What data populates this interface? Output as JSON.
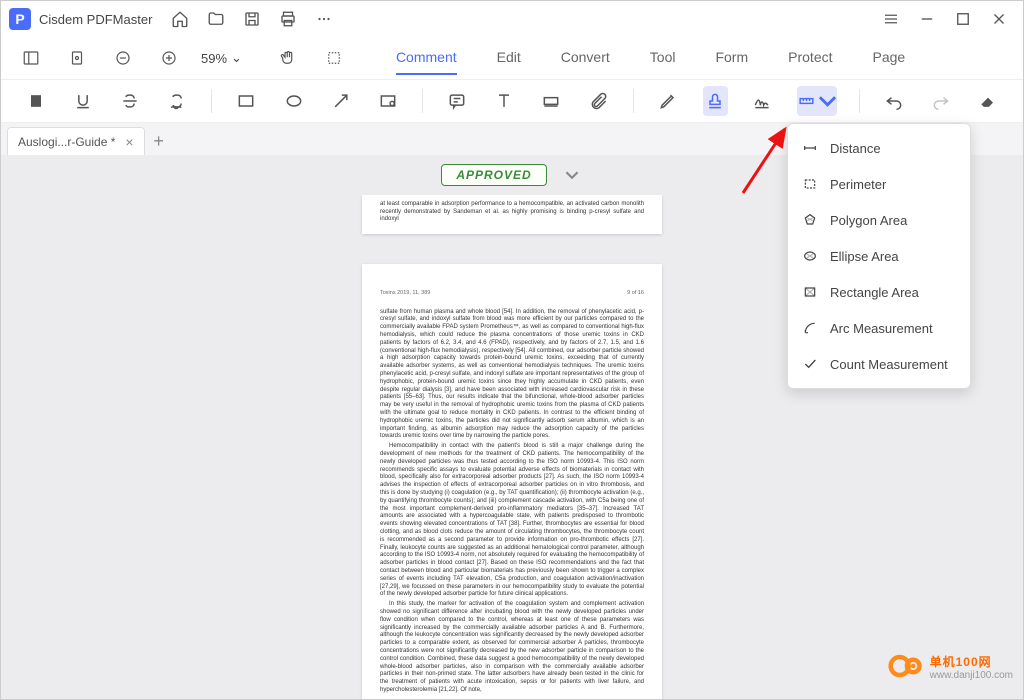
{
  "app": {
    "logo_letter": "P",
    "name": "Cisdem PDFMaster"
  },
  "zoom": {
    "value": "59%",
    "caret": "⌄"
  },
  "tabs": [
    "Comment",
    "Edit",
    "Convert",
    "Tool",
    "Form",
    "Protect",
    "Page"
  ],
  "active_tab": "Comment",
  "file": {
    "name": "Auslogi...r-Guide *",
    "close": "×"
  },
  "stamp": {
    "label": "APPROVED"
  },
  "menu": {
    "items": [
      {
        "label": "Distance"
      },
      {
        "label": "Perimeter"
      },
      {
        "label": "Polygon Area"
      },
      {
        "label": "Ellipse Area"
      },
      {
        "label": "Rectangle Area"
      },
      {
        "label": "Arc Measurement"
      },
      {
        "label": "Count Measurement"
      }
    ]
  },
  "doc": {
    "frag": "at least comparable in adsorption performance to a hemocompatible, an activated carbon monolith recently demonstrated by Sandeman et al. as highly promising is binding p-cresyl sulfate and indoxyl",
    "header_left": "Toxins 2019, 11, 389",
    "header_right": "9 of 16",
    "p1": "sulfate from human plasma and whole blood [54]. In addition, the removal of phenylacetic acid, p-cresyl sulfate, and indoxyl sulfate from blood was more efficient by our particles compared to the commercially available FPAD system Prometheus™, as well as compared to conventional high-flux hemodialysis, which could reduce the plasma concentrations of those uremic toxins in CKD patients by factors of 6.2, 3.4, and 4.6 (FPAD), respectively, and by factors of 2.7, 1.5, and 1.6 (conventional high-flux hemodialysis), respectively [54]. All combined, our adsorber particle showed a high adsorption capacity towards protein-bound uremic toxins, exceeding that of currently available adsorber systems, as well as conventional hemodialysis techniques. The uremic toxins phenylacetic acid, p-cresyl sulfate, and indoxyl sulfate are important representatives of the group of hydrophobic, protein-bound uremic toxins since they highly accumulate in CKD patients, even despite regular dialysis [3], and have been associated with increased cardiovascular risk in these patients [55–63]. Thus, our results indicate that the bifunctional, whole-blood adsorber particles may be very useful in the removal of hydrophobic uremic toxins from the plasma of CKD patients with the ultimate goal to reduce mortality in CKD patients. In contrast to the efficient binding of hydrophobic uremic toxins, the particles did not significantly adsorb serum albumin, which is an important finding, as albumin adsorption may reduce the adsorption capacity of the particles towards uremic toxins over time by narrowing the particle pores.",
    "p2": "Hemocompatibility in contact with the patient's blood is still a major challenge during the development of new methods for the treatment of CKD patients. The hemocompatibility of the newly developed particles was thus tested according to the ISO norm 10993-4. This ISO norm recommends specific assays to evaluate potential adverse effects of biomaterials in contact with blood, specifically also for extracorporeal adsorber products [27]. As such, the ISO norm 10993-4 advises the inspection of effects of extracorporeal adsorber particles on in vitro thrombosis, and this is done by studying (i) coagulation (e.g., by TAT quantification); (ii) thrombocyte activation (e.g., by quantifying thrombocyte counts); and (iii) complement cascade activation, with C5a being one of the most important complement-derived pro-inflammatory mediators [35–37]. Increased TAT amounts are associated with a hypercoagulable state, with patients predisposed to thrombotic events showing elevated concentrations of TAT [38]. Further, thrombocytes are essential for blood clotting, and as blood clots reduce the amount of circulating thrombocytes, the thrombocyte count is recommended as a second parameter to provide information on pro-thrombotic effects [27]. Finally, leukocyte counts are suggested as an additional hematological control parameter, although according to the ISO 10993-4 norm, not absolutely required for evaluating the hemocompatibility of adsorber particles in blood contact [27]. Based on these ISO recommendations and the fact that contact between blood and particular biomaterials has previously been shown to trigger a complex series of events including TAT elevation, C5a production, and coagulation activation/inactivation [27,29], we focussed on these parameters in our hemocompatibility study to evaluate the potential of the newly developed adsorber particle for future clinical applications.",
    "p3": "In this study, the marker for activation of the coagulation system and complement activation showed no significant difference after incubating blood with the newly developed particles under flow condition when compared to the control, whereas at least one of these parameters was significantly increased by the commercially available adsorber particles A and B. Furthermore, although the leukocyte concentration was significantly decreased by the newly developed adsorber particles to a comparable extent, as observed for commercial adsorber A particles, thrombocyte concentrations were not significantly decreased by the new adsorber particle in comparison to the control condition. Combined, these data suggest a good hemocompatibility of the newly developed whole-blood adsorber particles, also in comparison with the commercially available adsorber particles in their non-primed state. The latter adsorbers have already been tested in the clinic for the treatment of patients with acute intoxication, sepsis or for patients with liver failure, and hypercholesterolemia [21,22]. Of note,"
  },
  "watermark": {
    "main": "单机100网",
    "sub": "www.danji100.com"
  }
}
